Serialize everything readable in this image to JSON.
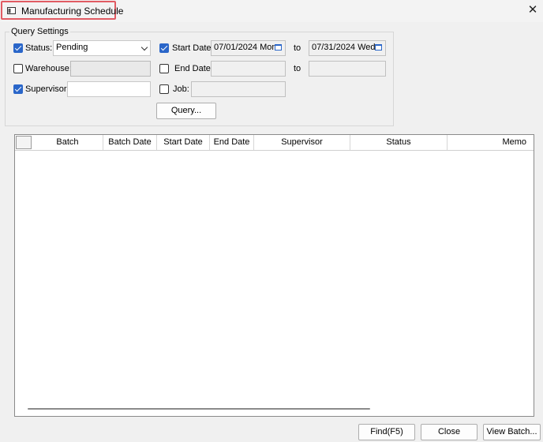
{
  "window": {
    "title": "Manufacturing Schedule",
    "close_symbol": "✕"
  },
  "query": {
    "group_title": "Query Settings",
    "status": {
      "label": "Status:",
      "checked": true,
      "value": "Pending"
    },
    "warehouse": {
      "label": "Warehouse:",
      "checked": false,
      "value": ""
    },
    "supervisor": {
      "label": "Supervisor:",
      "checked": true,
      "value": ""
    },
    "start_date": {
      "label": "Start Date:",
      "checked": true,
      "from": "07/01/2024 Mon",
      "to_label": "to",
      "to": "07/31/2024 Wed"
    },
    "end_date": {
      "label": "End Date:",
      "checked": false,
      "from": "",
      "to_label": "to",
      "to": ""
    },
    "job": {
      "label": "Job:",
      "checked": false,
      "value": ""
    },
    "query_button": "Query..."
  },
  "grid": {
    "columns": [
      "Batch",
      "Batch Date",
      "Start Date",
      "End Date",
      "Supervisor",
      "Status",
      "Memo"
    ],
    "rows": []
  },
  "footer": {
    "find_button": "Find(F5)",
    "close_button": "Close",
    "view_batch_button": "View Batch..."
  },
  "colors": {
    "accent": "#2a66c9",
    "title_highlight": "#e15b63"
  },
  "icons": {
    "app": "window-icon",
    "close": "close-icon",
    "combo": "chevron-down-icon",
    "date": "calendar-icon"
  }
}
